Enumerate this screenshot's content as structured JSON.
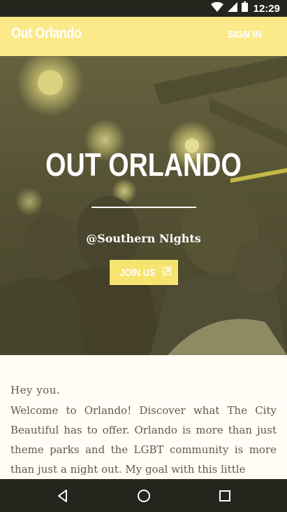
{
  "status_bar": {
    "time": "12:29",
    "icons": [
      "wifi-icon",
      "signal-icon",
      "battery-icon"
    ]
  },
  "app_bar": {
    "title": "Out Orlando",
    "sign_in_label": "SIGN IN"
  },
  "hero": {
    "title": "OUT ORLANDO",
    "venue": "@Southern Nights",
    "join_label": "JOIN US",
    "join_icon": "external-link-icon"
  },
  "content": {
    "greeting": "Hey you.",
    "intro": "Welcome to Orlando! Discover what The City Beautiful has to offer. Orlando is more than just theme parks and the LGBT community is more than just a night out. My goal with this little"
  },
  "nav_bar": {
    "buttons": [
      "back-icon",
      "home-icon",
      "recents-icon"
    ]
  },
  "colors": {
    "accent": "#fbe98a",
    "button": "#f6e370",
    "system_bar": "#26251d",
    "body_text": "#5d5b4c",
    "page_background": "#fffdf6"
  }
}
